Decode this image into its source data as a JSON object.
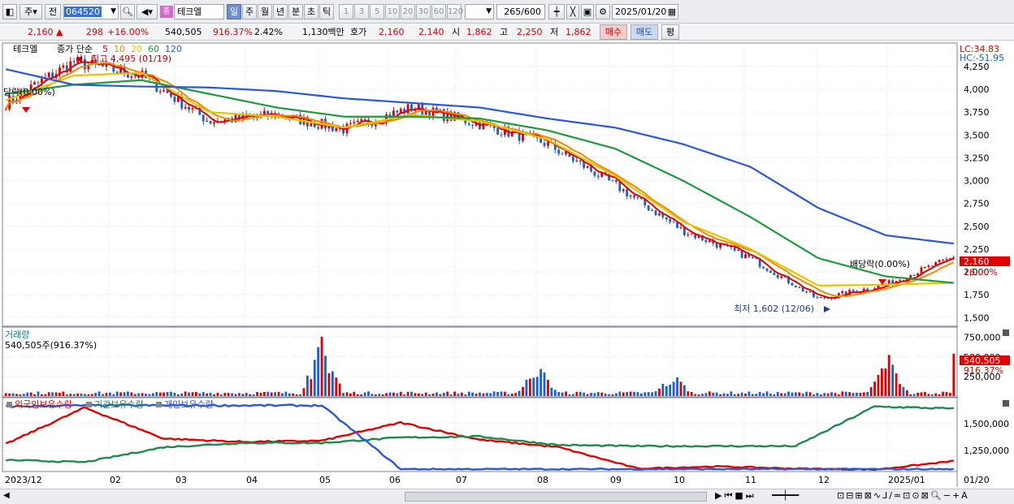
{
  "toolbar": {
    "type_code": "주",
    "prev": "전",
    "stock_code": "064520",
    "badge": "종",
    "stock_name": "테크엘",
    "periods": [
      "일",
      "주",
      "월",
      "년",
      "분",
      "초",
      "틱"
    ],
    "active_period": "일",
    "minutes": [
      "1",
      "3",
      "5",
      "10",
      "20",
      "30",
      "60",
      "120"
    ],
    "count": "265",
    "count_total": "/600",
    "date": "2025/01/20"
  },
  "quote": {
    "price": "2,160",
    "change": "298",
    "change_pct": "+16.00%",
    "volume": "540,505",
    "vol_ratio": "916.37%",
    "turnover": "2.42%",
    "amount": "1,130백만",
    "ask_label": "호가",
    "ask": "2,160",
    "bid": "2,140",
    "open_label": "시",
    "open": "1,862",
    "high_label": "고",
    "high": "2,250",
    "low_label": "저",
    "low": "1,862",
    "buy": "매수",
    "sell": "매도",
    "eval": "평"
  },
  "price_panel": {
    "stock": "테크엘",
    "legend_prefix": "종가 단순",
    "ma": [
      {
        "label": "5",
        "color": "#e00000"
      },
      {
        "label": "10",
        "color": "#f08a00"
      },
      {
        "label": "20",
        "color": "#e6c400"
      },
      {
        "label": "60",
        "color": "#1f9a3c"
      },
      {
        "label": "120",
        "color": "#2b58d8"
      }
    ],
    "lc": "LC:34.83",
    "hc": "HC:-51.95",
    "high_note": "최고 4,495 (01/19)",
    "low_note": "최저 1,602 (12/06)",
    "div_left": "당락(0.00%)",
    "div_right": "배당락(0.00%)",
    "last_price": "2,160",
    "last_pct": "16.00%",
    "up_color": "#e00000",
    "down_color": "#1a5fd0"
  },
  "volume_panel": {
    "title": "거래량",
    "subtitle": "540,505주(916.37%)",
    "last": "540,505",
    "last_pct": "916.37%"
  },
  "holdings_panel": {
    "legend": [
      {
        "label": "외국인보유수량",
        "color": "#e00000"
      },
      {
        "label": "기관보유수량",
        "color": "#1f8a4c"
      },
      {
        "label": "개인보유수량",
        "color": "#2b58d8"
      }
    ]
  },
  "x_axis": {
    "labels": [
      "2023/12",
      "02",
      "03",
      "04",
      "05",
      "06",
      "07",
      "08",
      "09",
      "10",
      "11",
      "12",
      "2025/01"
    ],
    "right_label": "01/20"
  },
  "chart_data": [
    {
      "type": "line",
      "title": "",
      "ylim": [
        1440,
        4480
      ],
      "y_ticks": [
        1500,
        1750,
        2000,
        2250,
        2500,
        2750,
        3000,
        3250,
        3500,
        3750,
        4000,
        4250
      ],
      "x": [
        "2023/12",
        "02",
        "03",
        "04",
        "05",
        "06",
        "07",
        "08",
        "09",
        "10",
        "11",
        "12",
        "2025/01",
        "01/20"
      ],
      "series": [
        {
          "name": "종가",
          "values": [
            3850,
            4300,
            4150,
            3650,
            3720,
            3560,
            3800,
            3620,
            3400,
            2950,
            2450,
            2150,
            1700,
            1862,
            2160
          ]
        },
        {
          "name": "20",
          "values": [
            3880,
            4150,
            4180,
            3750,
            3700,
            3580,
            3720,
            3650,
            3450,
            3050,
            2550,
            2250,
            1850,
            1860,
            1880
          ]
        },
        {
          "name": "60",
          "values": [
            3950,
            4050,
            4100,
            3950,
            3800,
            3700,
            3700,
            3680,
            3550,
            3350,
            3000,
            2600,
            2150,
            1950,
            1880
          ]
        },
        {
          "name": "120",
          "values": [
            4220,
            4050,
            4030,
            4020,
            3980,
            3900,
            3850,
            3800,
            3680,
            3580,
            3400,
            3150,
            2700,
            2400,
            2310
          ]
        }
      ]
    },
    {
      "type": "bar",
      "title": "거래량",
      "ylim": [
        0,
        850000
      ],
      "y_ticks": [
        250000,
        500000,
        750000
      ],
      "last": 540505,
      "peaks": [
        {
          "x": "05",
          "value": 780000
        },
        {
          "x": "08",
          "value": 470000
        },
        {
          "x": "10",
          "value": 300000
        },
        {
          "x": "2025/01",
          "value": 540505
        }
      ]
    },
    {
      "type": "line",
      "title": "보유수량",
      "ylim": [
        1060000,
        1720000
      ],
      "y_ticks": [
        1250000,
        1500000
      ],
      "x": [
        "2023/12",
        "02",
        "03",
        "04",
        "05",
        "06",
        "07",
        "08",
        "09",
        "10",
        "11",
        "12",
        "2025/01"
      ],
      "series": [
        {
          "name": "외국인보유수량",
          "values": [
            1310000,
            1650000,
            1360000,
            1330000,
            1340000,
            1510000,
            1350000,
            1280000,
            1080000,
            1100000,
            1080000,
            1070000,
            1150000
          ]
        },
        {
          "name": "기관보유수량",
          "values": [
            1160000,
            1140000,
            1280000,
            1320000,
            1320000,
            1370000,
            1380000,
            1300000,
            1290000,
            1290000,
            1290000,
            1660000,
            1640000
          ]
        },
        {
          "name": "개인보유수량",
          "values": [
            1660000,
            1670000,
            1670000,
            1670000,
            1670000,
            1075000,
            1075000,
            1075000,
            1075000,
            1075000,
            1075000,
            1075000,
            1075000
          ]
        }
      ]
    }
  ]
}
